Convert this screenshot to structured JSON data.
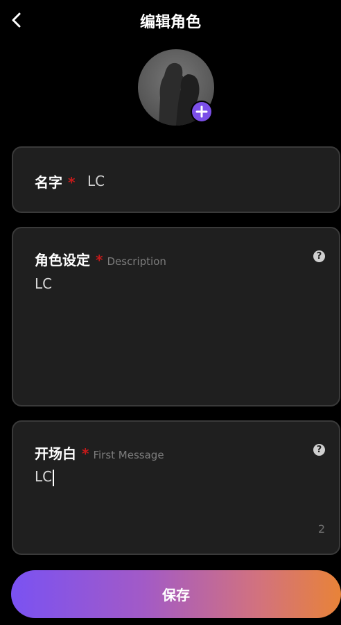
{
  "header": {
    "title": "编辑角色",
    "back_icon": "chevron-left-icon"
  },
  "avatar": {
    "add_icon": "plus-icon"
  },
  "name_field": {
    "label": "名字",
    "required_mark": "*",
    "value": "LC"
  },
  "description_field": {
    "label": "角色设定",
    "required_mark": "*",
    "hint": "Description",
    "value": "LC",
    "help_icon": "question-icon",
    "help_glyph": "?"
  },
  "first_message_field": {
    "label": "开场白",
    "required_mark": "*",
    "hint": "First Message",
    "value": "LC",
    "char_count": "2",
    "help_icon": "question-icon",
    "help_glyph": "?"
  },
  "save_button": {
    "label": "保存"
  },
  "colors": {
    "accent_purple": "#7a52f2",
    "accent_orange": "#e88338",
    "required_red": "#c41a1a",
    "card_bg": "#1f1f1f"
  }
}
